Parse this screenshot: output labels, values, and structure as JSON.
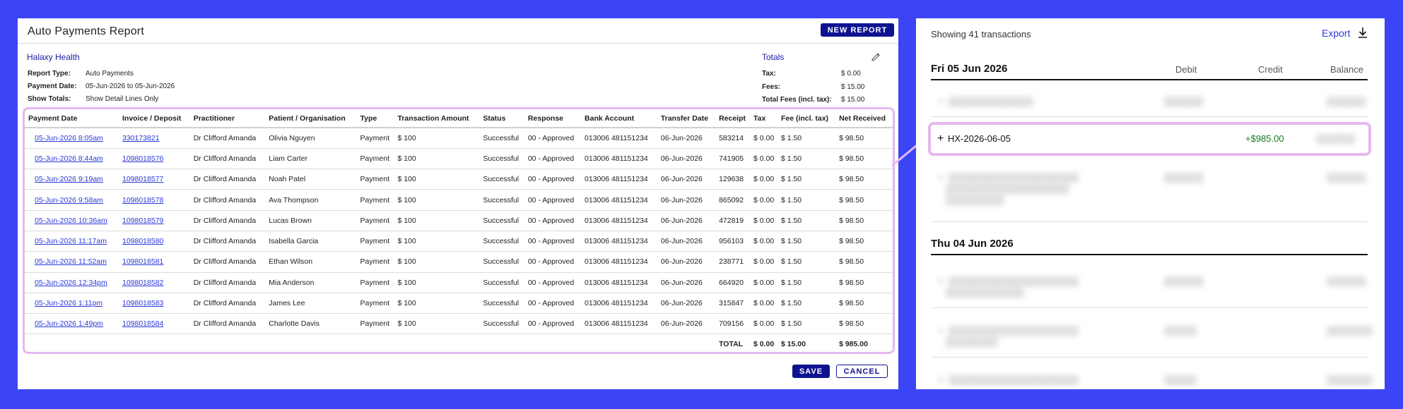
{
  "report": {
    "title": "Auto Payments Report",
    "new_report_label": "NEW REPORT",
    "org_name": "Halaxy Health",
    "meta": [
      {
        "label": "Report Type:",
        "value": "Auto Payments"
      },
      {
        "label": "Payment Date:",
        "value": "05-Jun-2026 to 05-Jun-2026"
      },
      {
        "label": "Show Totals:",
        "value": "Show Detail Lines Only"
      }
    ],
    "totals_title": "Totals",
    "totals": [
      {
        "label": "Tax:",
        "value": "$ 0.00"
      },
      {
        "label": "Fees:",
        "value": "$ 15.00"
      },
      {
        "label": "Total Fees (incl. tax):",
        "value": "$ 15.00"
      }
    ],
    "columns": [
      "Payment Date",
      "Invoice / Deposit",
      "Practitioner",
      "Patient / Organisation",
      "Type",
      "Transaction Amount",
      "Status",
      "Response",
      "Bank Account",
      "Transfer Date",
      "Receipt",
      "Tax",
      "Fee (incl. tax)",
      "Net Received"
    ],
    "rows": [
      [
        "05-Jun-2026 8:05am",
        "330173821",
        "Dr Clifford Amanda",
        "Olivia Nguyen",
        "Payment",
        "$ 100",
        "Successful",
        "00 - Approved",
        "013006 481151234",
        "06-Jun-2026",
        "583214",
        "$ 0.00",
        "$ 1.50",
        "$ 98.50"
      ],
      [
        "05-Jun-2026 8:44am",
        "1098018576",
        "Dr Clifford Amanda",
        "Liam Carter",
        "Payment",
        "$ 100",
        "Successful",
        "00 - Approved",
        "013006 481151234",
        "06-Jun-2026",
        "741905",
        "$ 0.00",
        "$ 1.50",
        "$ 98.50"
      ],
      [
        "05-Jun-2026 9:19am",
        "1098018577",
        "Dr Clifford Amanda",
        "Noah Patel",
        "Payment",
        "$ 100",
        "Successful",
        "00 - Approved",
        "013006 481151234",
        "06-Jun-2026",
        "129638",
        "$ 0.00",
        "$ 1.50",
        "$ 98.50"
      ],
      [
        "05-Jun-2026 9:58am",
        "1098018578",
        "Dr Clifford Amanda",
        "Ava Thompson",
        "Payment",
        "$ 100",
        "Successful",
        "00 - Approved",
        "013006 481151234",
        "06-Jun-2026",
        "865092",
        "$ 0.00",
        "$ 1.50",
        "$ 98.50"
      ],
      [
        "05-Jun-2026 10:36am",
        "1098018579",
        "Dr Clifford Amanda",
        "Lucas Brown",
        "Payment",
        "$ 100",
        "Successful",
        "00 - Approved",
        "013006 481151234",
        "06-Jun-2026",
        "472819",
        "$ 0.00",
        "$ 1.50",
        "$ 98.50"
      ],
      [
        "05-Jun-2026 11:17am",
        "1098018580",
        "Dr Clifford Amanda",
        "Isabella Garcia",
        "Payment",
        "$ 100",
        "Successful",
        "00 - Approved",
        "013006 481151234",
        "06-Jun-2026",
        "956103",
        "$ 0.00",
        "$ 1.50",
        "$ 98.50"
      ],
      [
        "05-Jun-2026 11:52am",
        "1098018581",
        "Dr Clifford Amanda",
        "Ethan Wilson",
        "Payment",
        "$ 100",
        "Successful",
        "00 - Approved",
        "013006 481151234",
        "06-Jun-2026",
        "238771",
        "$ 0.00",
        "$ 1.50",
        "$ 98.50"
      ],
      [
        "05-Jun-2026 12:34pm",
        "1098018582",
        "Dr Clifford Amanda",
        "Mia Anderson",
        "Payment",
        "$ 100",
        "Successful",
        "00 - Approved",
        "013006 481151234",
        "06-Jun-2026",
        "664920",
        "$ 0.00",
        "$ 1.50",
        "$ 98.50"
      ],
      [
        "05-Jun-2026 1:11pm",
        "1098018583",
        "Dr Clifford Amanda",
        "James Lee",
        "Payment",
        "$ 100",
        "Successful",
        "00 - Approved",
        "013006 481151234",
        "06-Jun-2026",
        "315847",
        "$ 0.00",
        "$ 1.50",
        "$ 98.50"
      ],
      [
        "05-Jun-2026 1:49pm",
        "1098018584",
        "Dr Clifford Amanda",
        "Charlotte Davis",
        "Payment",
        "$ 100",
        "Successful",
        "00 - Approved",
        "013006 481151234",
        "06-Jun-2026",
        "709156",
        "$ 0.00",
        "$ 1.50",
        "$ 98.50"
      ]
    ],
    "total_row": {
      "label": "TOTAL",
      "tax": "$ 0.00",
      "fee": "$ 15.00",
      "net": "$ 985.00"
    },
    "save_label": "SAVE",
    "cancel_label": "CANCEL"
  },
  "transactions": {
    "showing": "Showing 41 transactions",
    "export_label": "Export",
    "icons": {
      "download": "download-icon",
      "plus": "plus-icon",
      "pencil": "pencil-icon"
    },
    "columns": {
      "debit": "Debit",
      "credit": "Credit",
      "balance": "Balance"
    },
    "day1": "Fri 05 Jun 2026",
    "day2": "Thu 04 Jun 2026",
    "highlight": {
      "ref": "HX-2026-06-05",
      "credit": "+$985.00"
    },
    "credit_color": "#157a1c",
    "accent": "#0d1390",
    "highlight_border": "#e6b8f0"
  }
}
